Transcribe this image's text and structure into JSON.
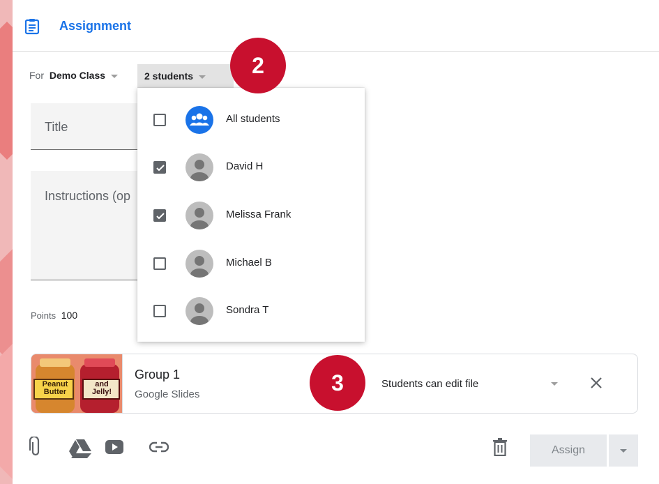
{
  "header": {
    "title": "Assignment",
    "icon": "assignment-icon"
  },
  "for_row": {
    "label": "For",
    "class_name": "Demo Class",
    "students_selector": "2 students"
  },
  "form": {
    "title_placeholder": "Title",
    "instructions_placeholder": "Instructions (op",
    "points_label": "Points",
    "points_value": "100"
  },
  "dropdown": {
    "items": [
      {
        "label": "All students",
        "checked": false,
        "avatar": "group-icon"
      },
      {
        "label": "David H",
        "checked": true,
        "avatar": "person-icon"
      },
      {
        "label": "Melissa Frank",
        "checked": true,
        "avatar": "person-icon"
      },
      {
        "label": "Michael B",
        "checked": false,
        "avatar": "person-icon"
      },
      {
        "label": "Sondra T",
        "checked": false,
        "avatar": "person-icon"
      }
    ]
  },
  "badges": {
    "step2": "2",
    "step3": "3"
  },
  "attachment": {
    "thumb_text_1": "Peanut\nButter",
    "thumb_text_2": "and\nJelly!",
    "title": "Group 1",
    "subtitle": "Google Slides",
    "permission": "Students can edit file"
  },
  "toolbar": {
    "icons": [
      "attach-icon",
      "drive-icon",
      "youtube-icon",
      "link-icon",
      "trash-icon"
    ],
    "assign_label": "Assign"
  },
  "colors": {
    "accent": "#1a73e8",
    "badge": "#c8102e",
    "background": "#f0b8b8"
  }
}
